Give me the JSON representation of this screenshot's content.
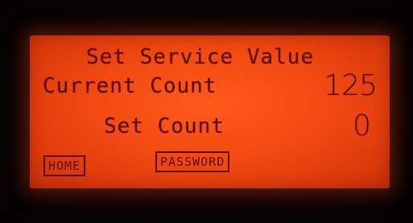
{
  "screen": {
    "title": "Set Service Value",
    "current_count_label": "Current Count",
    "current_count_value": "125",
    "set_count_label": "Set Count",
    "set_count_value": "0"
  },
  "softkeys": {
    "home_label": "HOME",
    "password_label": "PASSWORD"
  },
  "colors": {
    "backlight": "#f24a12",
    "segment": "#5a0d04",
    "bezel": "#050303"
  }
}
